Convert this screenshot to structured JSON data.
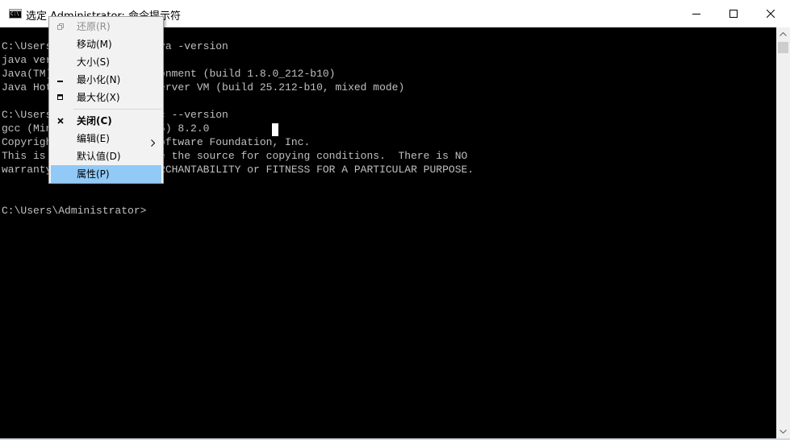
{
  "window": {
    "title": "选定 Administrator: 命令提示符",
    "icon_text": "C:\\"
  },
  "console": {
    "lines": [
      "C:\\Users\\Administrator>java -version",
      "java version \"1.8.0_212\"",
      "Java(TM) SE Runtime Environment (build 1.8.0_212-b10)",
      "Java HotSpot(TM) 64-Bit Server VM (build 25.212-b10, mixed mode)",
      "",
      "C:\\Users\\Administrator>gcc --version",
      "gcc (MinGW.org GCC-8.2.0-5) 8.2.0",
      "Copyright (C) 2018 Free Software Foundation, Inc.",
      "This is free software; see the source for copying conditions.  There is NO",
      "warranty; not even for MERCHANTABILITY or FITNESS FOR A PARTICULAR PURPOSE.",
      "",
      "",
      "C:\\Users\\Administrator>"
    ]
  },
  "system_menu": {
    "items": [
      {
        "label": "还原(R)",
        "icon": "restore-icon",
        "disabled": true
      },
      {
        "label": "移动(M)",
        "icon": ""
      },
      {
        "label": "大小(S)",
        "icon": ""
      },
      {
        "label": "最小化(N)",
        "icon": "minimize-icon"
      },
      {
        "label": "最大化(X)",
        "icon": "maximize-icon"
      },
      {
        "label": "关闭(C)",
        "icon": "close-icon",
        "bold": true
      },
      {
        "label": "编辑(E)",
        "icon": "",
        "submenu": true
      },
      {
        "label": "默认值(D)",
        "icon": ""
      },
      {
        "label": "属性(P)",
        "icon": "",
        "highlighted": true
      }
    ]
  },
  "colors": {
    "console_bg": "#000000",
    "console_text": "#c0c0c0",
    "menu_bg": "#f2f2f2",
    "menu_highlight": "#91c9f7"
  }
}
